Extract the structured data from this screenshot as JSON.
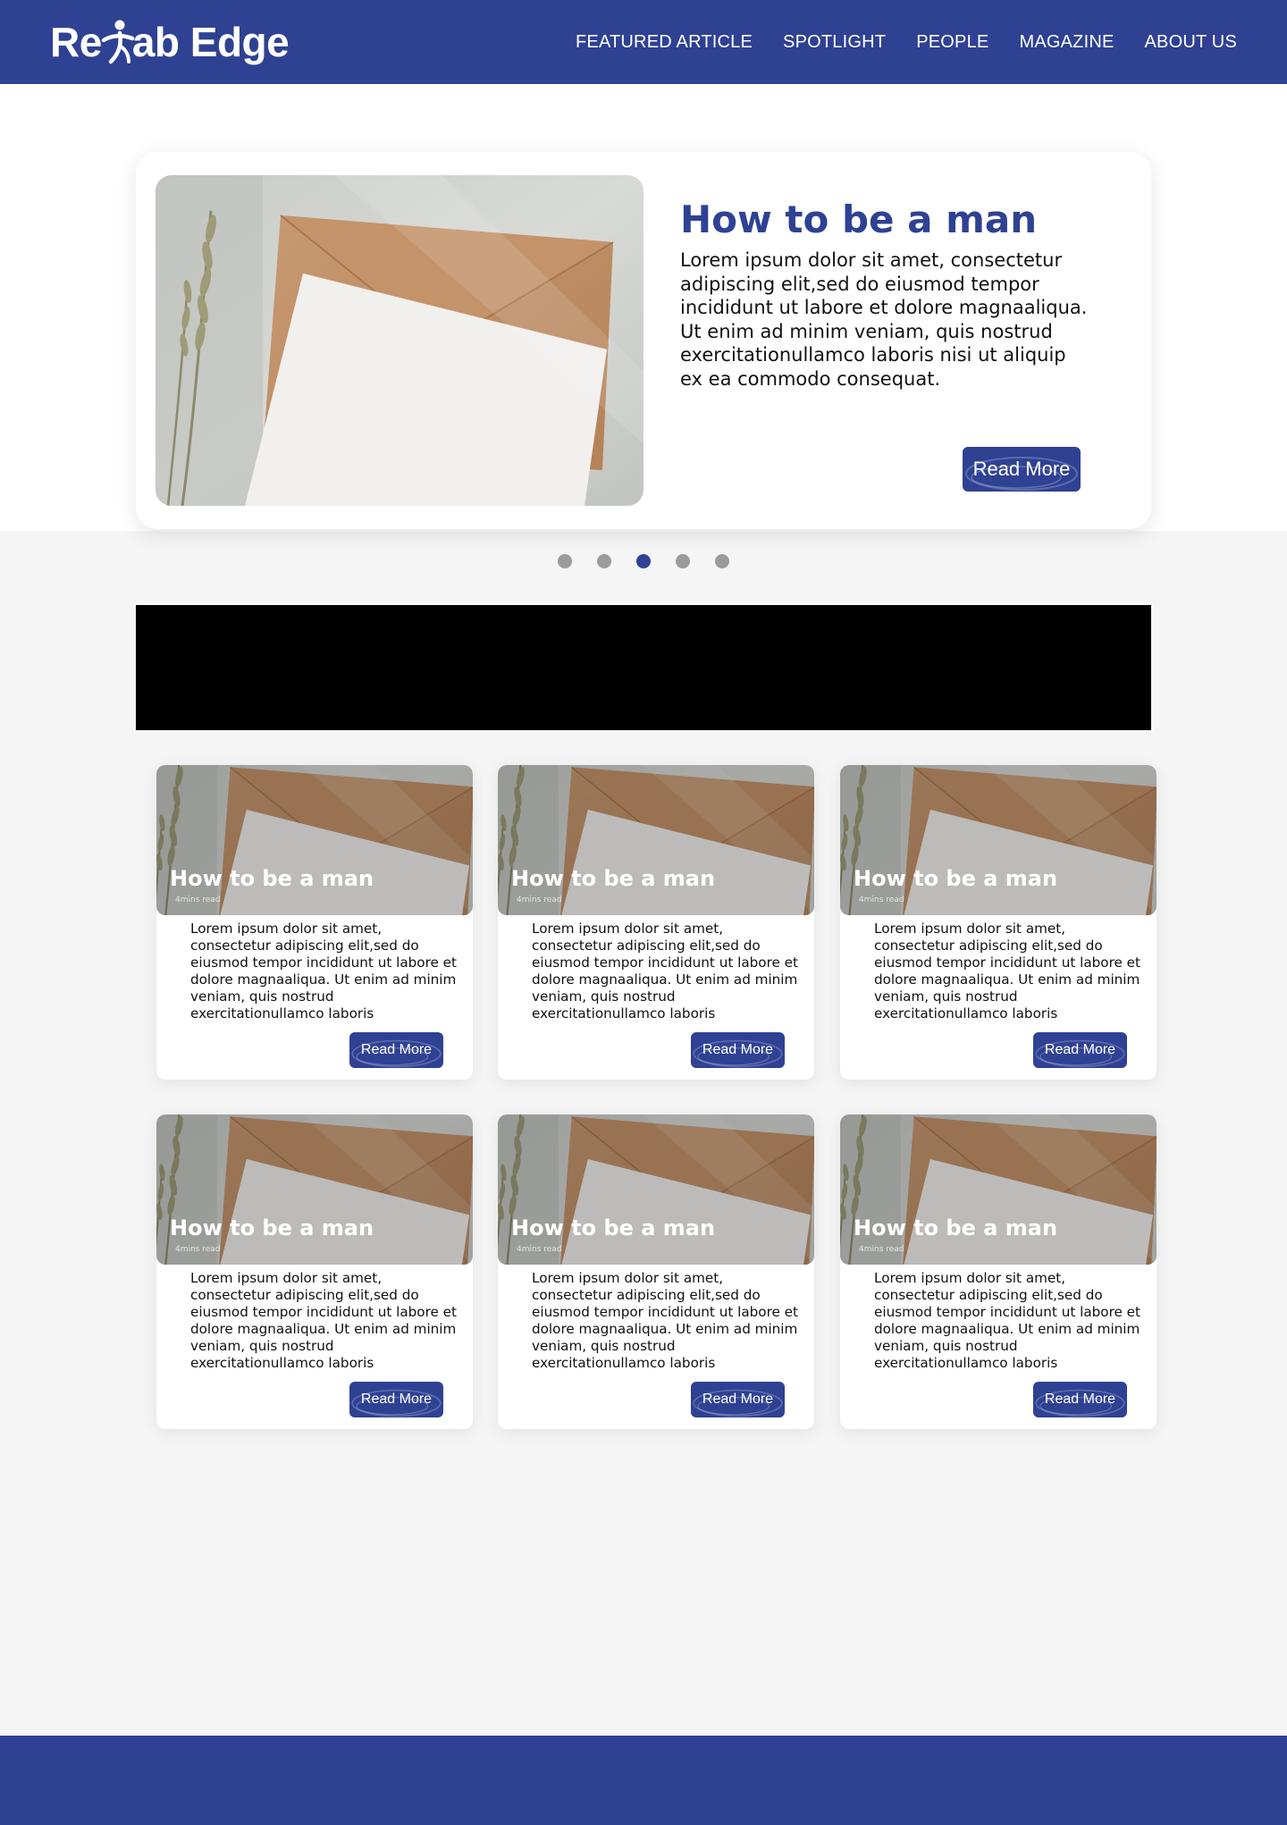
{
  "colors": {
    "brand": "#2f4193",
    "page_bg": "#f5f5f5",
    "banner": "#000000",
    "dot_inactive": "#9b9b9b"
  },
  "header": {
    "logo_before": "Re",
    "logo_after": "ab Edge",
    "nav": [
      "FEATURED ARTICLE",
      "SPOTLIGHT",
      "PEOPLE",
      "MAGAZINE",
      "ABOUT US"
    ]
  },
  "hero": {
    "title": "How to be a man",
    "body": "Lorem ipsum dolor sit amet, consectetur adipiscing elit,sed do eiusmod tempor incididunt ut labore et dolore magnaaliqua. Ut enim ad minim veniam, quis nostrud exercitationullamco laboris nisi ut aliquip ex ea commodo consequat.",
    "button": "Read More"
  },
  "carousel": {
    "count": 5,
    "active_index": 2
  },
  "cards": [
    {
      "title": "How to be a man",
      "read_time": "4mins read",
      "body": "Lorem ipsum dolor sit amet, consectetur adipiscing elit,sed do eiusmod tempor incididunt ut labore et dolore magnaaliqua. Ut enim ad minim veniam, quis nostrud exercitationullamco laboris",
      "button": "Read More"
    },
    {
      "title": "How to be a man",
      "read_time": "4mins read",
      "body": "Lorem ipsum dolor sit amet, consectetur adipiscing elit,sed do eiusmod tempor incididunt ut labore et dolore magnaaliqua. Ut enim ad minim veniam, quis nostrud exercitationullamco laboris",
      "button": "Read More"
    },
    {
      "title": "How to be a man",
      "read_time": "4mins read",
      "body": "Lorem ipsum dolor sit amet, consectetur adipiscing elit,sed do eiusmod tempor incididunt ut labore et dolore magnaaliqua. Ut enim ad minim veniam, quis nostrud exercitationullamco laboris",
      "button": "Read More"
    },
    {
      "title": "How to be a man",
      "read_time": "4mins read",
      "body": "Lorem ipsum dolor sit amet, consectetur adipiscing elit,sed do eiusmod tempor incididunt ut labore et dolore magnaaliqua. Ut enim ad minim veniam, quis nostrud exercitationullamco laboris",
      "button": "Read More"
    },
    {
      "title": "How to be a man",
      "read_time": "4mins read",
      "body": "Lorem ipsum dolor sit amet, consectetur adipiscing elit,sed do eiusmod tempor incididunt ut labore et dolore magnaaliqua. Ut enim ad minim veniam, quis nostrud exercitationullamco laboris",
      "button": "Read More"
    },
    {
      "title": "How to be a man",
      "read_time": "4mins read",
      "body": "Lorem ipsum dolor sit amet, consectetur adipiscing elit,sed do eiusmod tempor incididunt ut labore et dolore magnaaliqua. Ut enim ad minim veniam, quis nostrud exercitationullamco laboris",
      "button": "Read More"
    }
  ]
}
